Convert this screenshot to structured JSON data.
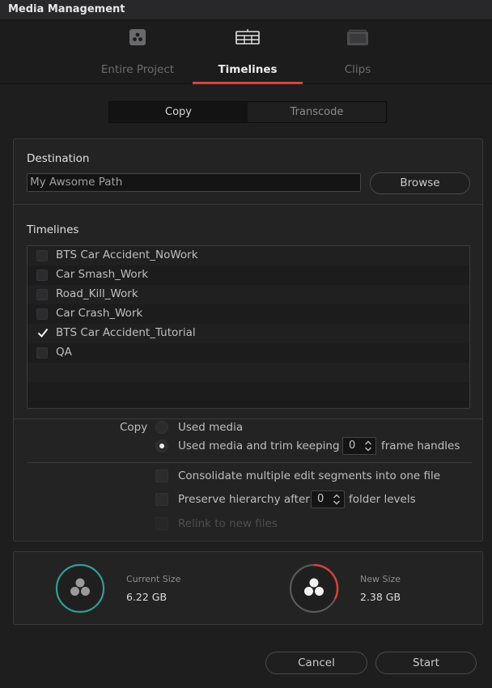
{
  "window": {
    "title": "Media Management"
  },
  "tabs": [
    {
      "label": "Entire Project",
      "icon": "davinci-logo-icon",
      "active": false
    },
    {
      "label": "Timelines",
      "icon": "timeline-icon",
      "active": true
    },
    {
      "label": "Clips",
      "icon": "clips-icon",
      "active": false
    }
  ],
  "mode": {
    "options": [
      "Copy",
      "Transcode"
    ],
    "selected": "Copy"
  },
  "destination": {
    "label": "Destination",
    "path": "My Awsome Path",
    "browse_label": "Browse"
  },
  "timelines": {
    "label": "Timelines",
    "items": [
      {
        "name": "BTS Car Accident_NoWork",
        "checked": false
      },
      {
        "name": "Car Smash_Work",
        "checked": false
      },
      {
        "name": "Road_Kill_Work",
        "checked": false
      },
      {
        "name": "Car Crash_Work",
        "checked": false
      },
      {
        "name": "BTS Car Accident_Tutorial",
        "checked": true
      },
      {
        "name": "QA",
        "checked": false
      }
    ]
  },
  "copy_options": {
    "label": "Copy",
    "used_media": "Used media",
    "used_media_trim": "Used media and trim keeping",
    "frame_handles_value": "0",
    "frame_handles_label": "frame handles",
    "selected": "Used media and trim keeping"
  },
  "extra_options": {
    "consolidate": "Consolidate multiple edit segments into one file",
    "preserve_prefix": "Preserve hierarchy after",
    "folder_levels_value": "0",
    "folder_levels_label": "folder levels",
    "relink": "Relink to new files"
  },
  "sizes": {
    "current": {
      "label": "Current Size",
      "value": "6.22 GB"
    },
    "new": {
      "label": "New Size",
      "value": "2.38 GB"
    }
  },
  "footer": {
    "cancel_label": "Cancel",
    "start_label": "Start"
  },
  "colors": {
    "accent_red": "#d6453a",
    "teal_ring": "#2f9e95"
  }
}
